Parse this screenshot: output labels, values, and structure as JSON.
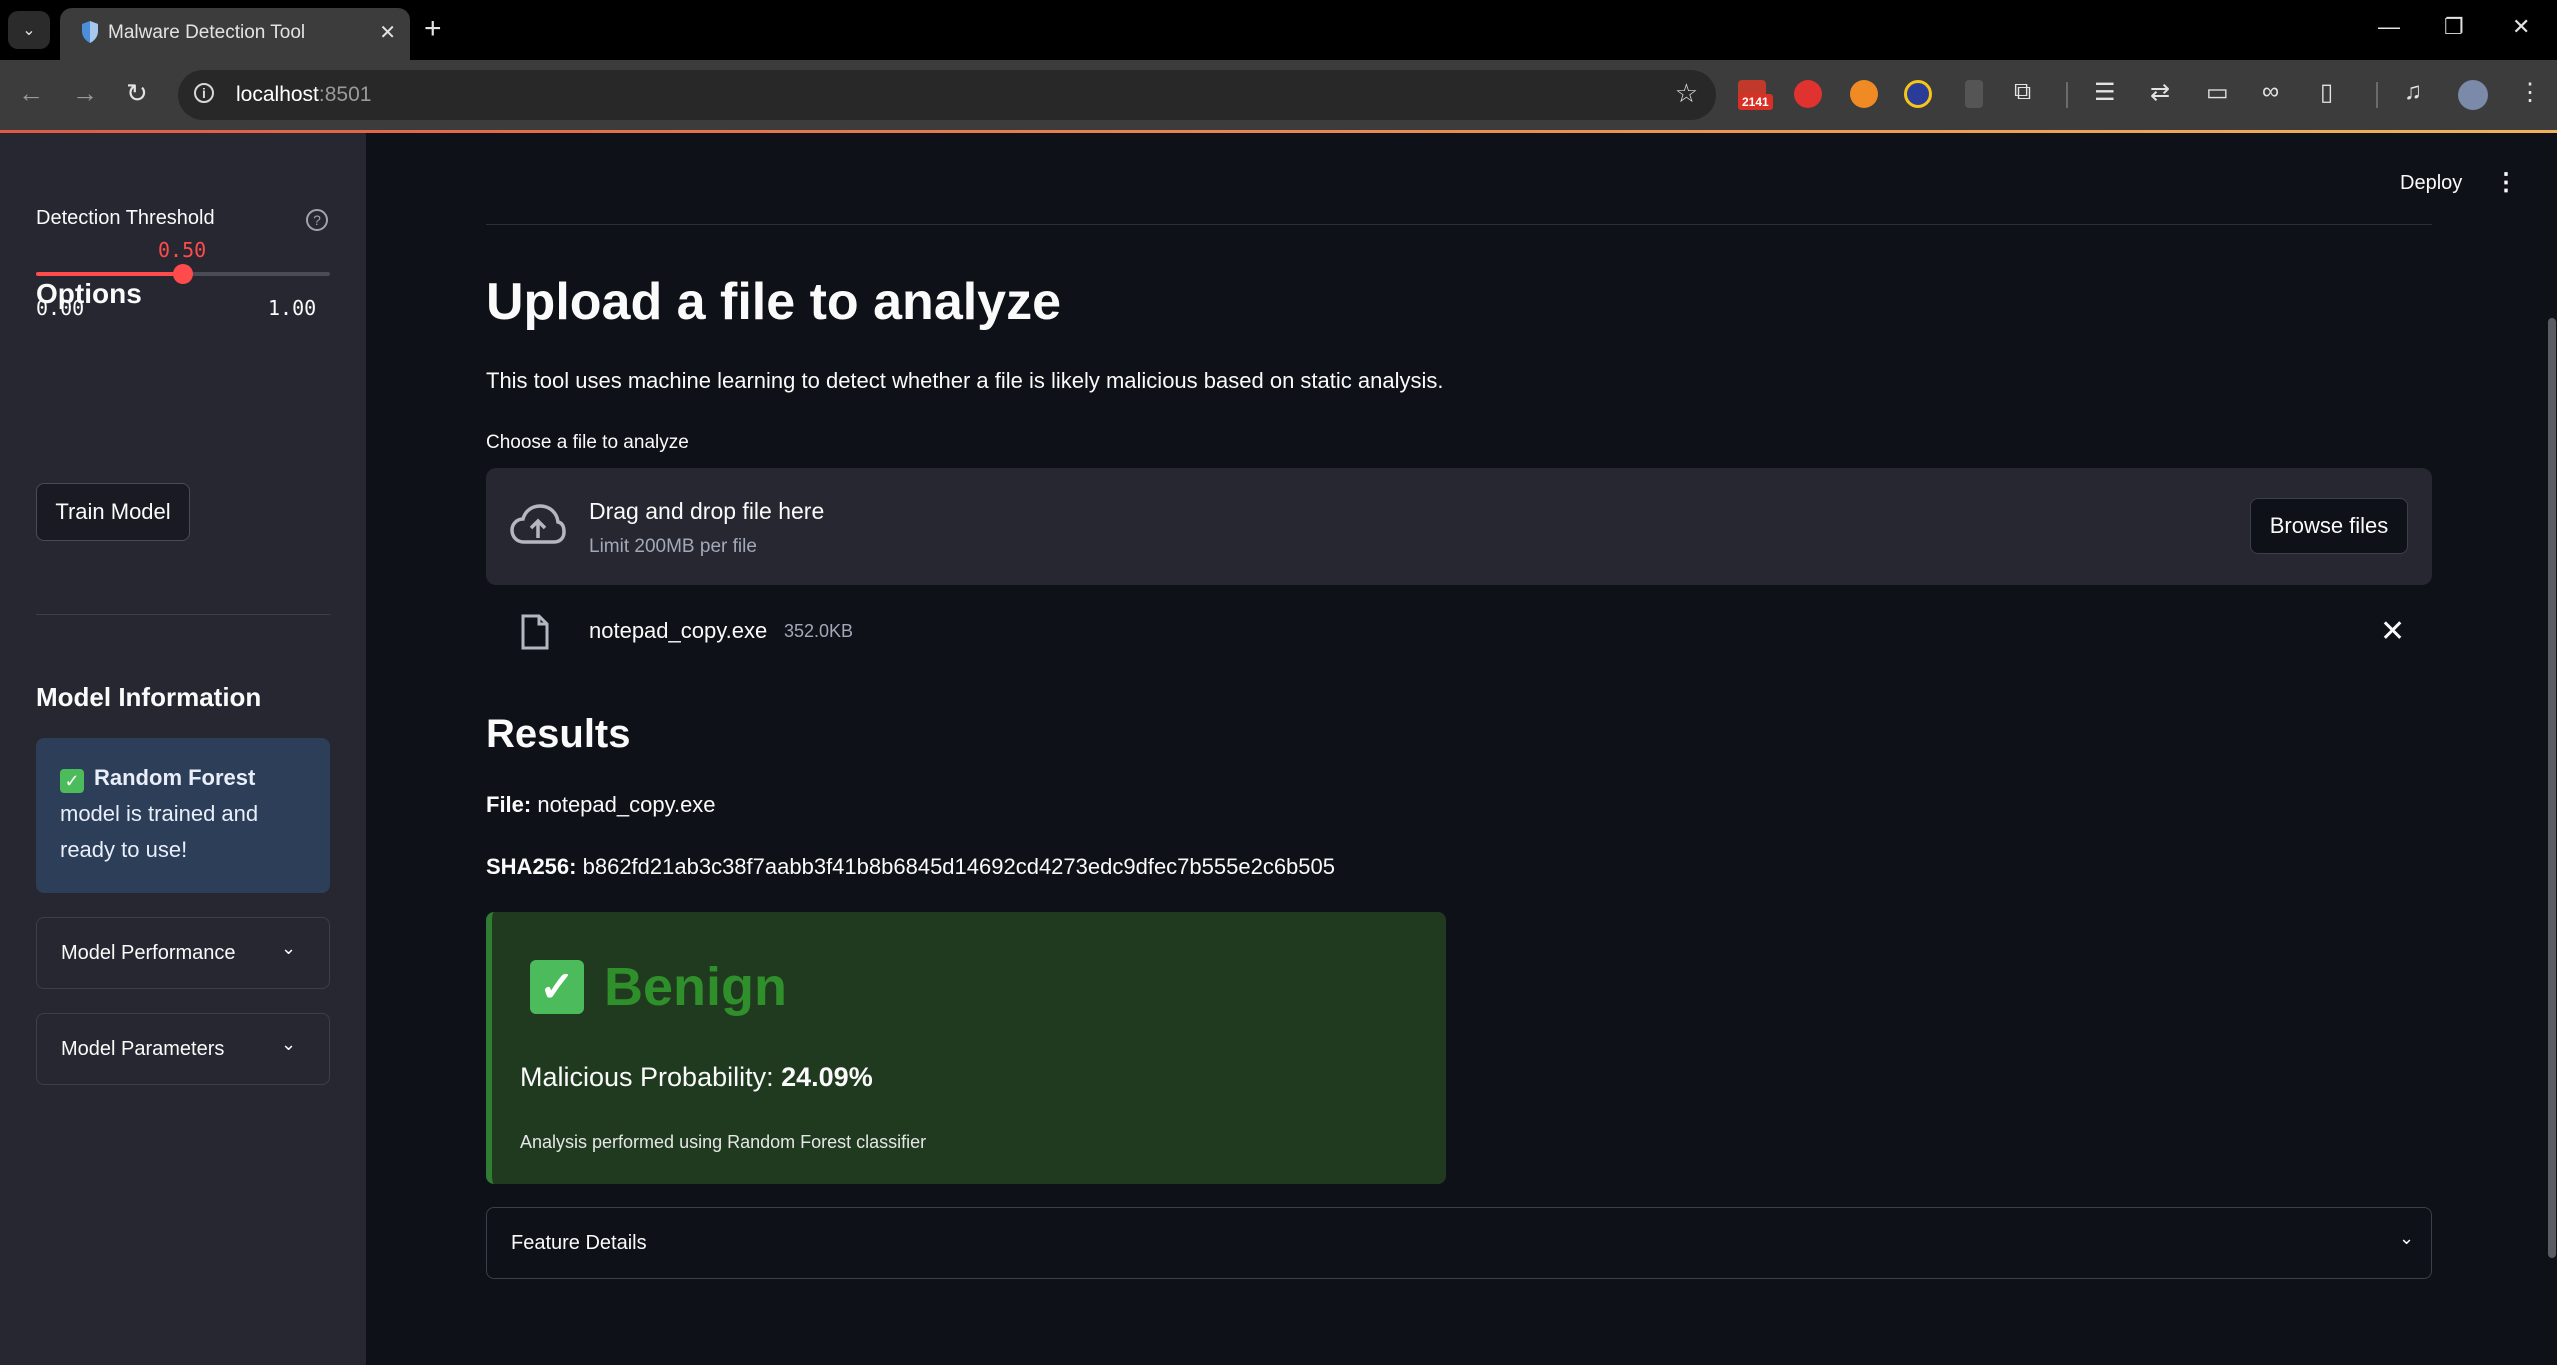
{
  "browser": {
    "tab_title": "Malware Detection Tool",
    "url_host": "localhost",
    "url_port": ":8501",
    "gmail_badge": "2141"
  },
  "header": {
    "deploy_label": "Deploy"
  },
  "sidebar": {
    "options_title": "Options",
    "threshold_label": "Detection Threshold",
    "threshold_value": "0.50",
    "threshold_fraction": 0.5,
    "threshold_min": "0.00",
    "threshold_max": "1.00",
    "train_button": "Train Model",
    "model_info_title": "Model Information",
    "model_status_bold": "Random Forest",
    "model_status_rest": "model is trained and ready to use!",
    "expanders": [
      "Model Performance",
      "Model Parameters"
    ]
  },
  "main": {
    "title": "Upload a file to analyze",
    "description": "This tool uses machine learning to detect whether a file is likely malicious based on static analysis.",
    "uploader_label": "Choose a file to analyze",
    "dropzone_title": "Drag and drop file here",
    "dropzone_limit": "Limit 200MB per file",
    "browse_button": "Browse files",
    "uploaded_file_name": "notepad_copy.exe",
    "uploaded_file_size": "352.0KB",
    "results_heading": "Results",
    "file_label": "File:",
    "file_value": "notepad_copy.exe",
    "sha_label": "SHA256:",
    "sha_value": "b862fd21ab3c38f7aabb3f41b8b6845d14692cd4273edc9dfec7b555e2c6b505",
    "verdict": "Benign",
    "prob_label": "Malicious Probability:",
    "prob_value": "24.09%",
    "analysis_note": "Analysis performed using Random Forest classifier",
    "feature_details": "Feature Details"
  },
  "colors": {
    "accent": "#ff4b4b",
    "benign_green": "#2f8f2a",
    "sidebar_bg": "#262730",
    "main_bg": "#0e1117"
  }
}
